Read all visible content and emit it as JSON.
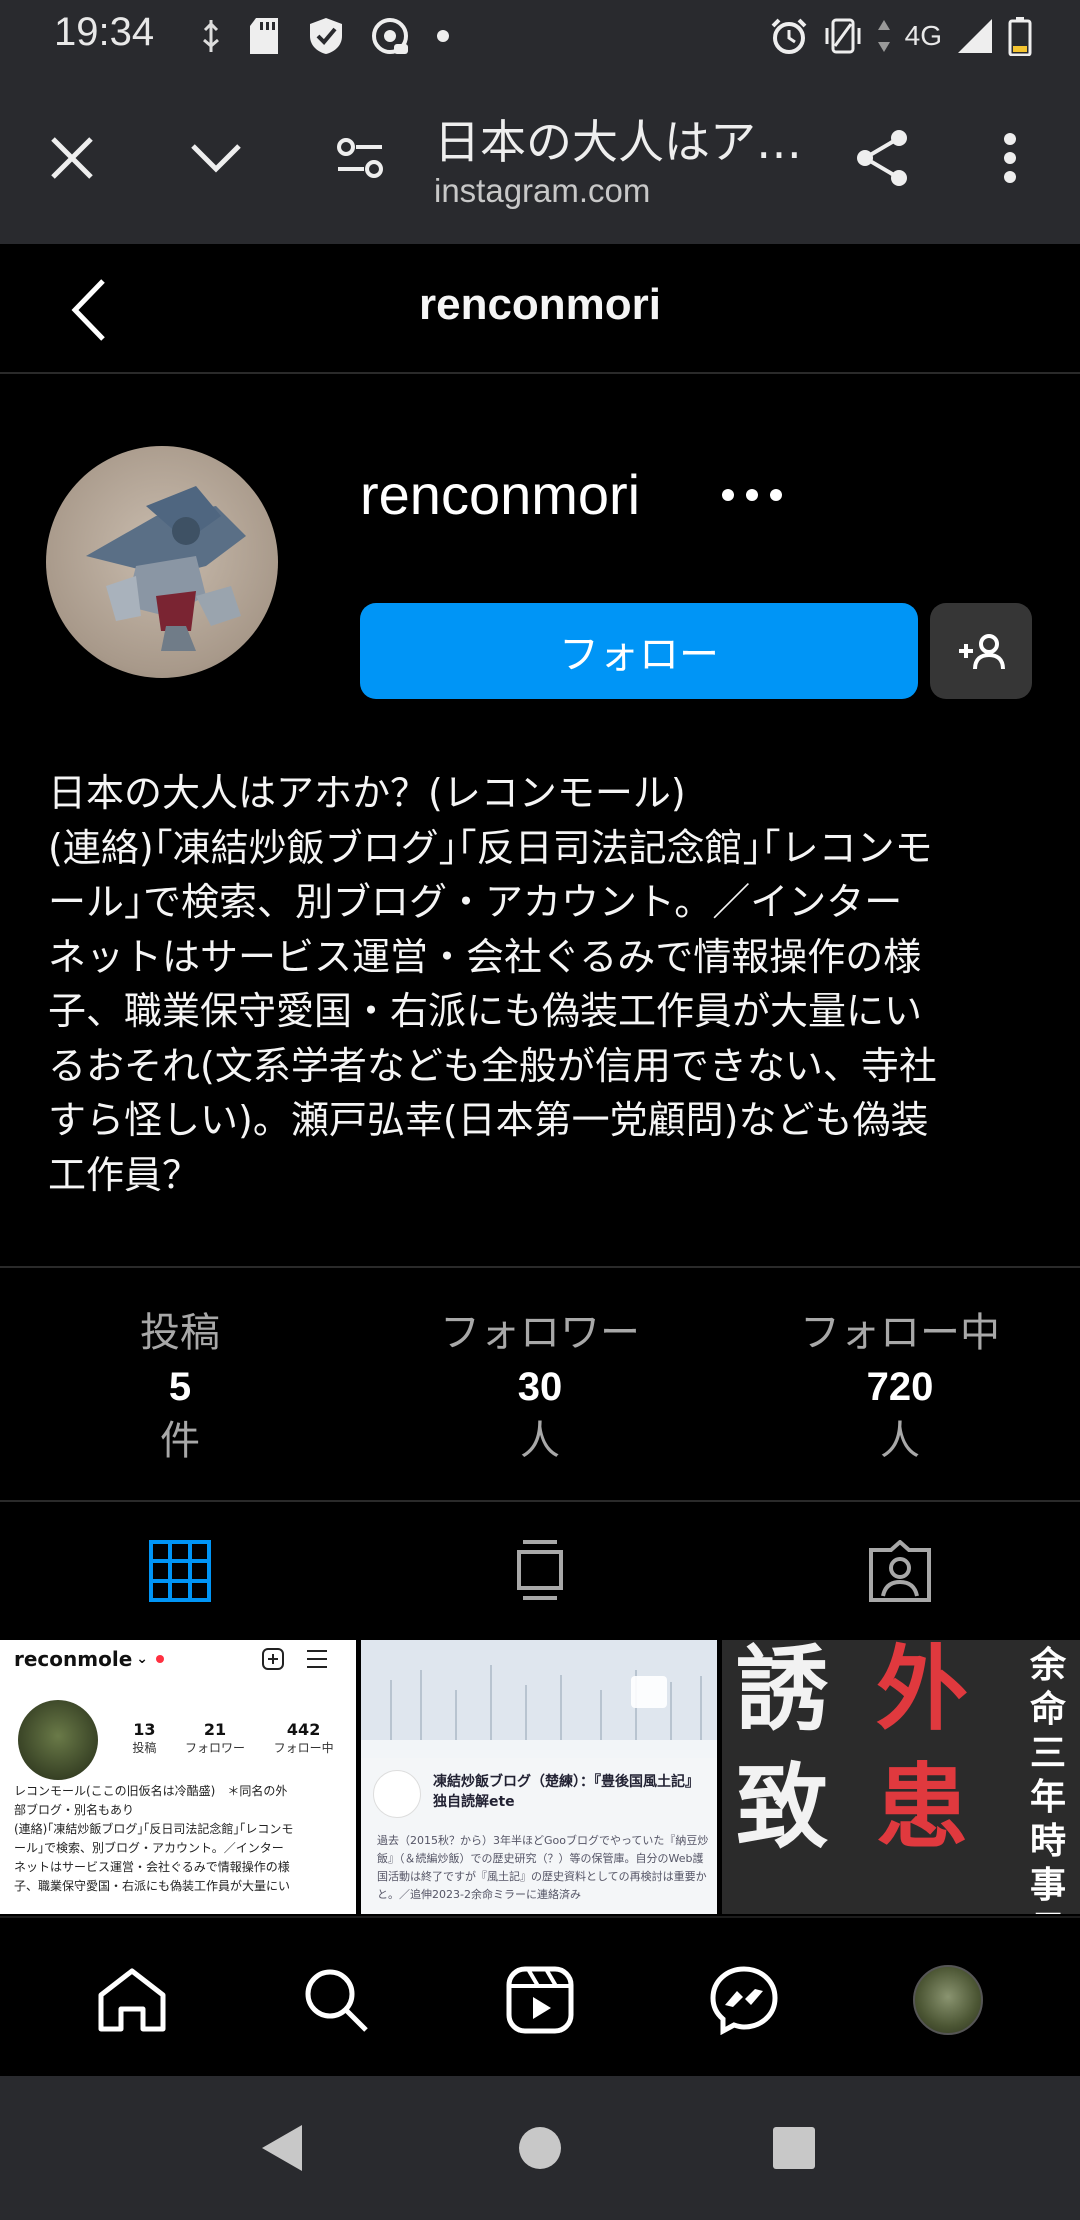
{
  "status_bar": {
    "time": "19:34",
    "network": "4G",
    "icons": [
      "usb-debug-icon",
      "sd-card-icon",
      "shield-icon",
      "gamepad-icon",
      "dot-icon",
      "alarm-icon",
      "vibrate-icon",
      "signal-icon",
      "battery-icon"
    ]
  },
  "browser": {
    "title": "日本の大人はア…",
    "url": "instagram.com"
  },
  "header": {
    "title": "renconmori"
  },
  "profile": {
    "username": "renconmori",
    "follow_label": "フォロー",
    "bio_lines": [
      "日本の大人はアホか？(レコンモール)",
      "(連絡)｢凍結炒飯ブログ｣｢反日司法記念館｣｢レコンモ",
      "ール｣で検索、別ブログ・アカウント。／インター",
      "ネットはサービス運営・会社ぐるみで情報操作の様",
      "子、職業保守愛国・右派にも偽装工作員が大量にい",
      "るおそれ(文系学者なども全般が信用できない、寺社",
      "すら怪しい)。瀬戸弘幸(日本第一党顧問)なども偽装",
      "工作員？"
    ]
  },
  "stats": {
    "posts": {
      "label": "投稿",
      "value": "5",
      "unit": "件"
    },
    "followers": {
      "label": "フォロワー",
      "value": "30",
      "unit": "人"
    },
    "following": {
      "label": "フォロー中",
      "value": "720",
      "unit": "人"
    }
  },
  "posts": {
    "post1": {
      "account": "reconmole",
      "counts": [
        {
          "num": "13",
          "label": "投稿"
        },
        {
          "num": "21",
          "label": "フォロワー"
        },
        {
          "num": "442",
          "label": "フォロー中"
        }
      ],
      "bio_lines": [
        "レコンモール(ここの旧仮名は冷酷盛)　＊同名の外",
        "部ブログ・別名もあり",
        "(連絡)｢凍結炒飯ブログ｣｢反日司法記念館｣｢レコンモ",
        "ール｣で検索、別ブログ・アカウント。／インター",
        "ネットはサービス運営・会社ぐるみで情報操作の様",
        "子、職業保守愛国・右派にも偽装工作員が大量にい"
      ]
    },
    "post2": {
      "title": "凍結炒飯ブログ（楚練）：『豊後国風土記』独自読解ete",
      "body": "過去（2015秋？から）3年半ほどGooブログでやっていた『納豆炒飯』（＆続編炒飯）での歴史研究（？）等の保管庫。自分のWeb護国活動は終了ですが『風土記』の歴史資料としての再検討は重要かと。／追伸2023-2余命ミラーに連絡済み"
    },
    "post3": {
      "left_top": "誘",
      "left_bottom": "致",
      "right_top": "外",
      "right_bottom": "患",
      "side": "余命三年時事日記"
    }
  },
  "colors": {
    "follow_button": "#0095f6",
    "tab_active": "#0095f6",
    "background": "#000000",
    "system_bar": "#292a2e"
  }
}
